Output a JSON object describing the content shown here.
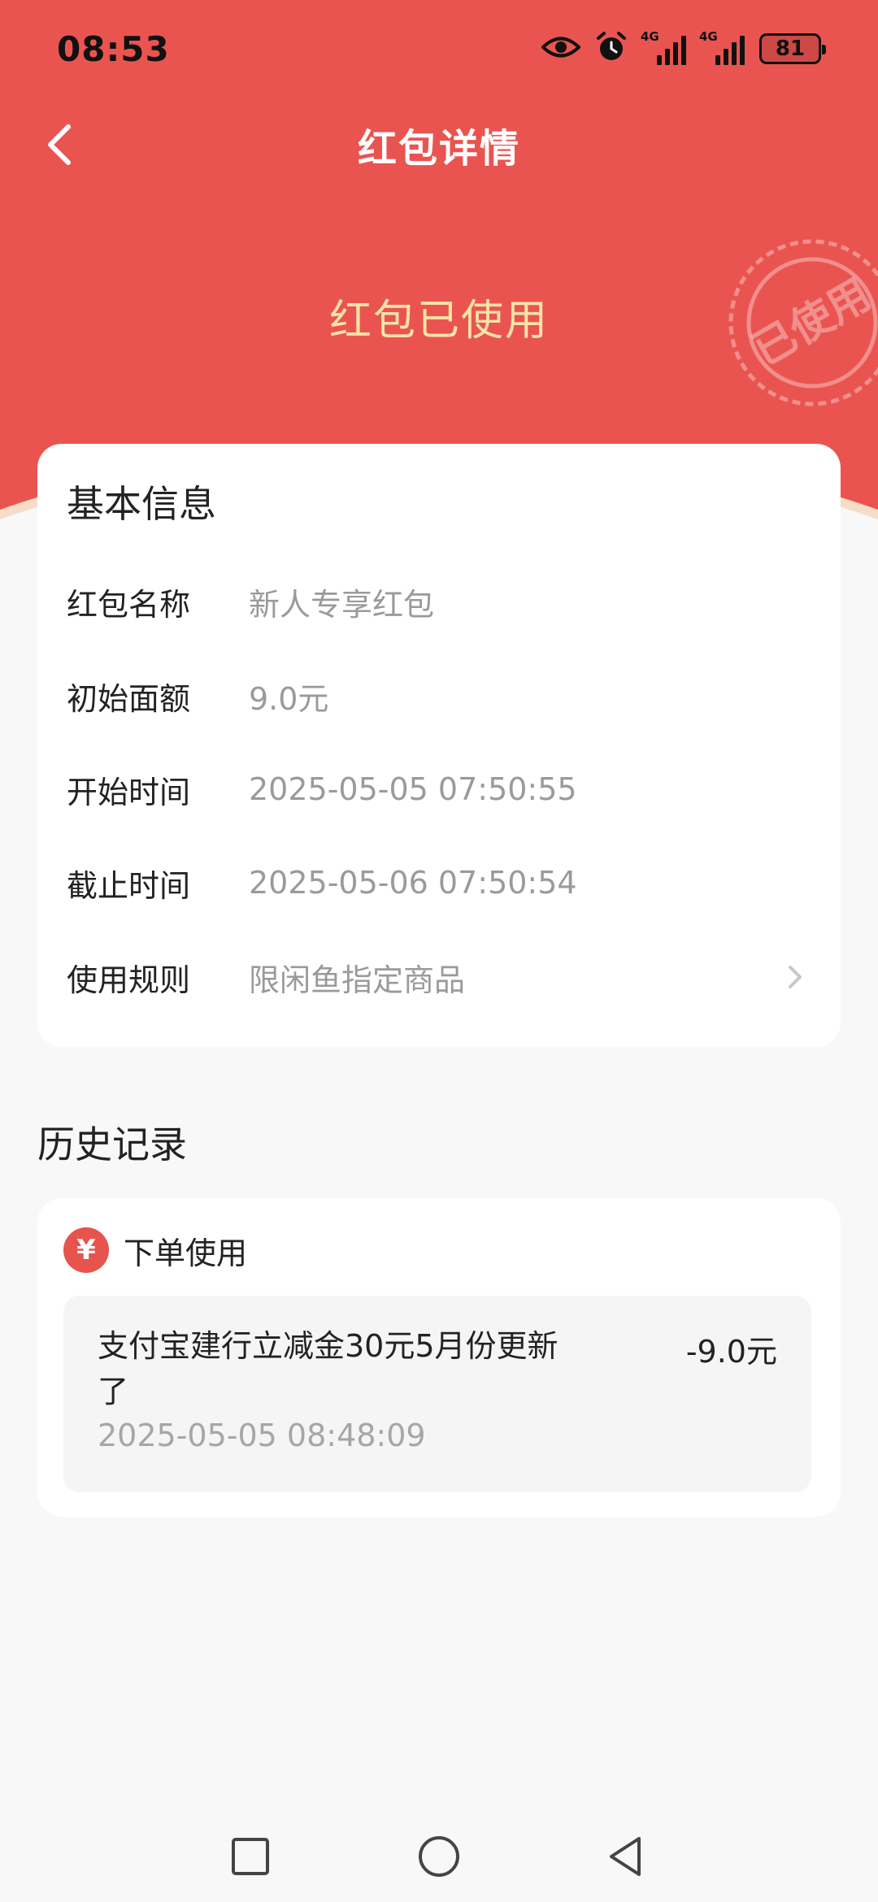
{
  "status_bar": {
    "time": "08:53",
    "icons": [
      "eye-icon",
      "alarm-icon",
      "signal-4g-icon",
      "signal-4g-icon"
    ],
    "network_label": "4G",
    "battery": "81"
  },
  "nav": {
    "title": "红包详情",
    "back_icon": "chevron-left-icon"
  },
  "header": {
    "status_text": "红包已使用",
    "stamp_text": "已使用",
    "colors": {
      "background": "#ea5450",
      "status_text": "#fbe3a8"
    }
  },
  "basic_info": {
    "title": "基本信息",
    "rows": [
      {
        "label": "红包名称",
        "value": "新人专享红包"
      },
      {
        "label": "初始面额",
        "value": "9.0元"
      },
      {
        "label": "开始时间",
        "value": "2025-05-05 07:50:55"
      },
      {
        "label": "截止时间",
        "value": "2025-05-06 07:50:54"
      },
      {
        "label": "使用规则",
        "value": "限闲鱼指定商品"
      }
    ]
  },
  "history": {
    "title": "历史记录",
    "type_icon": "yuan-icon",
    "type_icon_glyph": "¥",
    "type_label": "下单使用",
    "items": [
      {
        "description": "支付宝建行立减金30元5月份更新了",
        "time": "2025-05-05 08:48:09",
        "amount": "-9.0元"
      }
    ]
  },
  "system_nav": {
    "icons": [
      "recent-apps-icon",
      "home-icon",
      "back-triangle-icon"
    ]
  }
}
